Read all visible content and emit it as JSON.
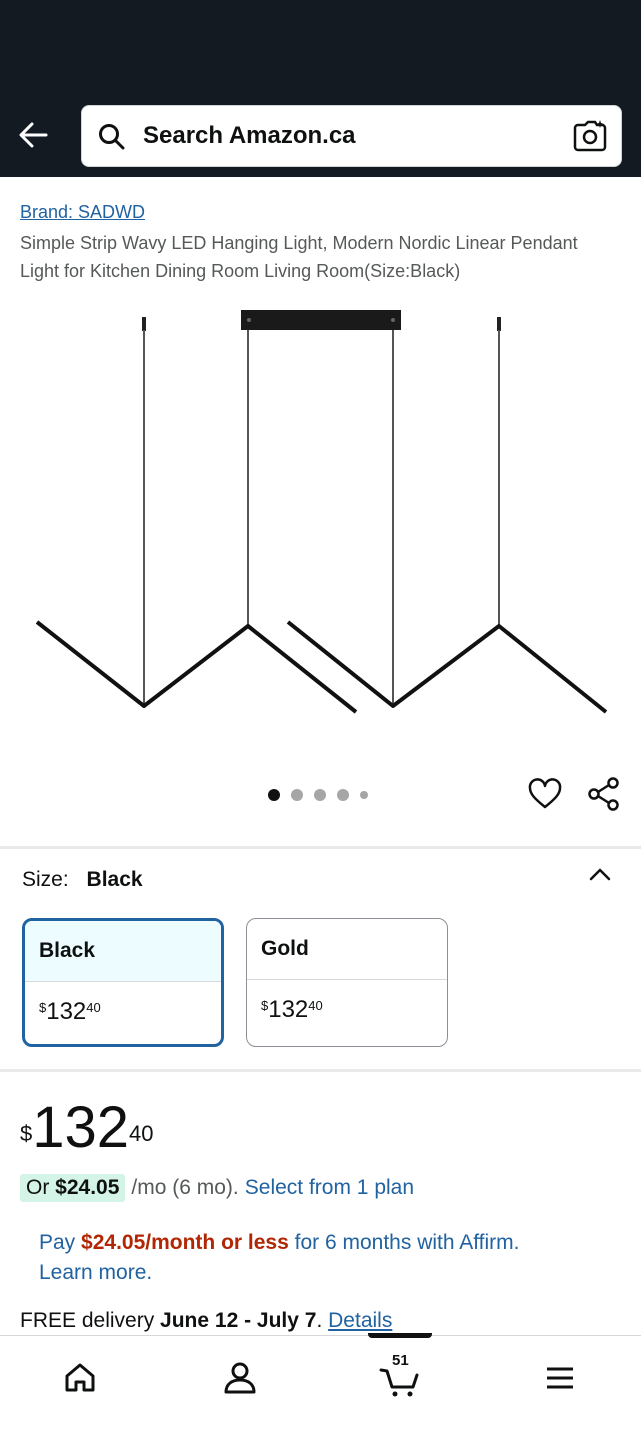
{
  "search": {
    "placeholder": "Search Amazon.ca"
  },
  "product": {
    "brand": "Brand: SADWD",
    "title": "Simple Strip Wavy LED Hanging Light, Modern Nordic Linear Pendant Light for Kitchen Dining Room Living Room(Size:Black)"
  },
  "carousel": {
    "image_count": 5,
    "active_index": 0
  },
  "size": {
    "label": "Size:",
    "selected": "Black",
    "options": [
      {
        "name": "Black",
        "price_symbol": "$",
        "price_whole": "132",
        "price_fraction": "40"
      },
      {
        "name": "Gold",
        "price_symbol": "$",
        "price_whole": "132",
        "price_fraction": "40"
      }
    ]
  },
  "price": {
    "symbol": "$",
    "whole": "132",
    "fraction": "40"
  },
  "installment": {
    "or": "Or",
    "amount": "$24.05",
    "rest": "/mo (6 mo).",
    "link": "Select from 1 plan"
  },
  "affirm": {
    "pay": "Pay",
    "amount": "$24.05/month or less",
    "rest": "for 6 months with Affirm.",
    "learn": "Learn more."
  },
  "delivery": {
    "prefix": "FREE delivery",
    "dates": "June 12 - July 7",
    "sep": ".",
    "details": "Details"
  },
  "bottom_nav": {
    "cart_count": "51"
  },
  "colors": {
    "header": "#131a22",
    "link": "#2162a1",
    "price_red": "#b12704",
    "plan_highlight": "#d4f4e8"
  }
}
